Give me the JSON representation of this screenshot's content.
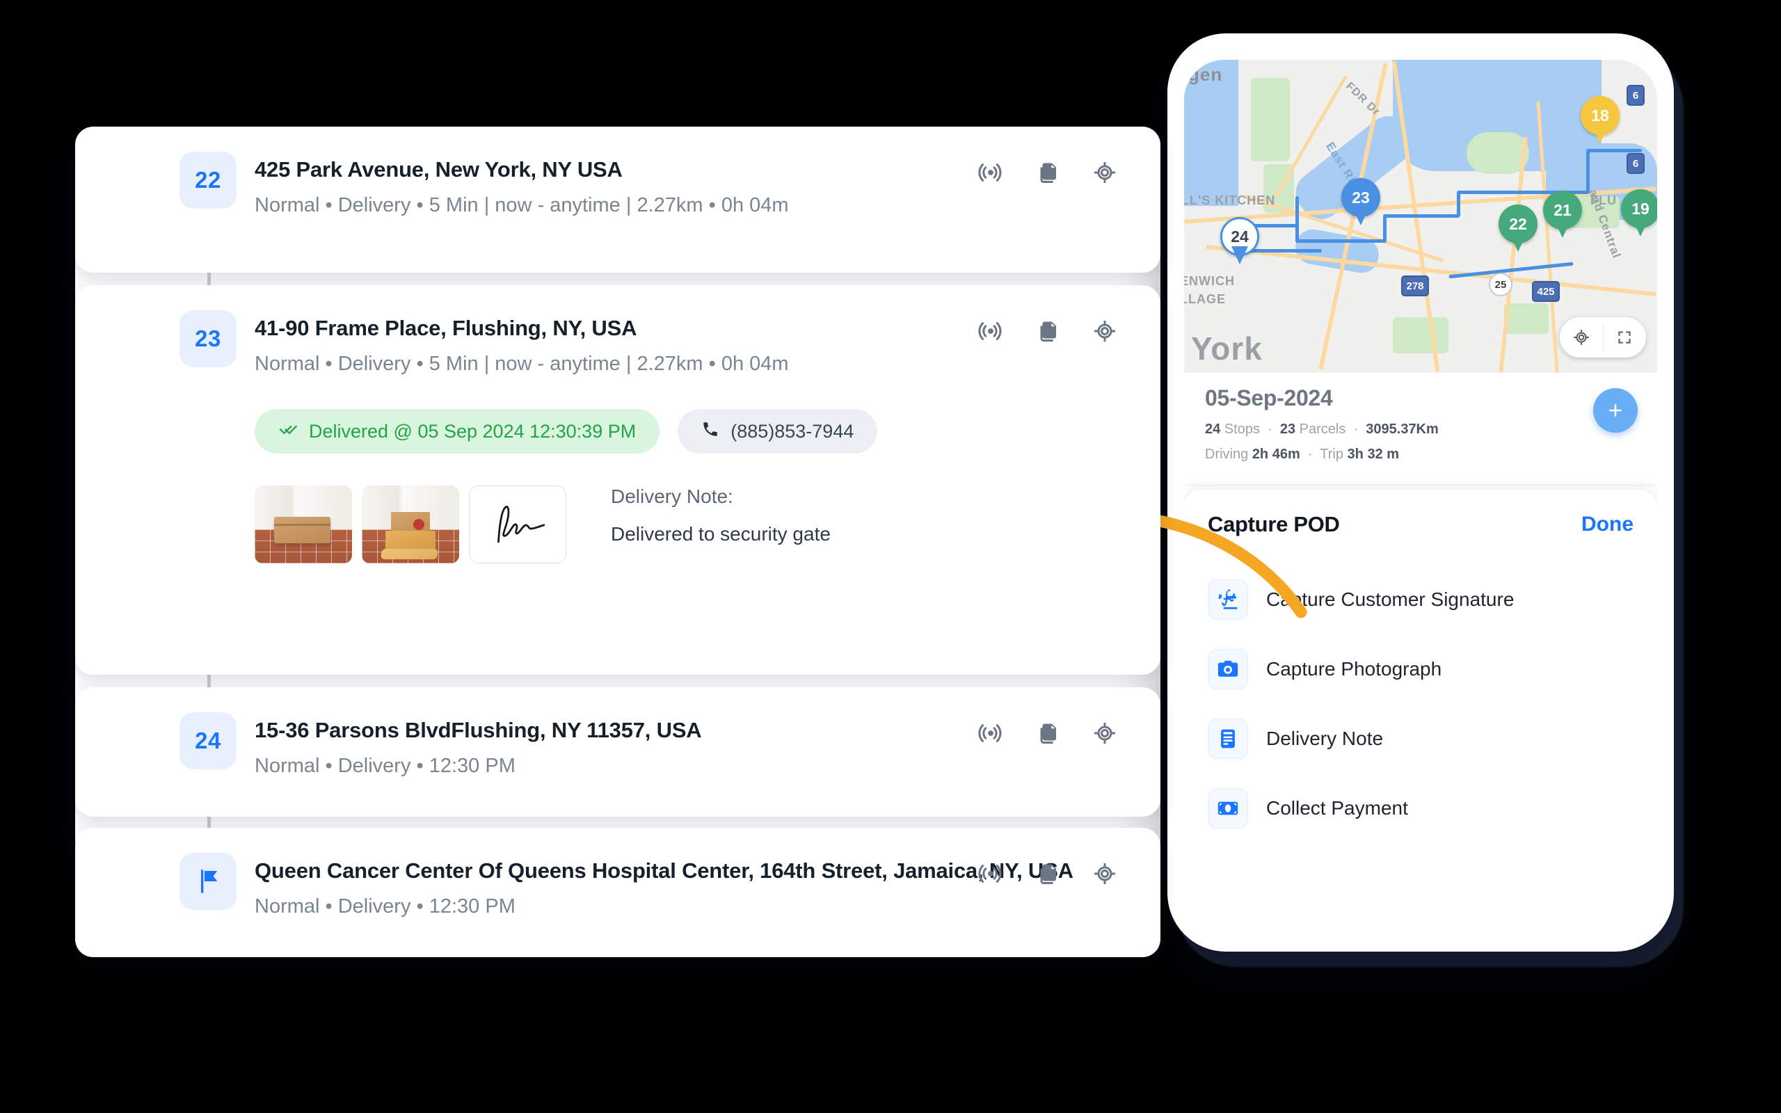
{
  "stop_list": {
    "rows": [
      {
        "badge": "22",
        "badge_type": "number",
        "address": "425 Park Avenue, New York, NY USA",
        "meta": "Normal • Delivery • 5 Min | now - anytime | 2.27km • 0h 04m",
        "actions": [
          "broadcast-icon",
          "copy-icon",
          "locate-icon"
        ]
      },
      {
        "badge": "23",
        "badge_type": "number",
        "address": "41-90 Frame Place, Flushing, NY, USA",
        "meta": "Normal  •  Delivery  •  5 Min | now - anytime | 2.27km • 0h 04m",
        "actions": [
          "broadcast-icon",
          "copy-icon",
          "locate-icon"
        ],
        "delivered_chip": "Delivered @ 05 Sep 2024 12:30:39 PM",
        "phone_chip": "(885)853-7944",
        "pod": {
          "photo_count": 2,
          "has_signature": true,
          "note_label": "Delivery Note:",
          "note_value": "Delivered to security gate"
        }
      },
      {
        "badge": "24",
        "badge_type": "number",
        "address": "15-36 Parsons BlvdFlushing, NY 11357, USA",
        "meta": "Normal  •  Delivery  •  12:30 PM",
        "actions": [
          "broadcast-icon",
          "copy-icon",
          "locate-icon"
        ]
      },
      {
        "badge": "",
        "badge_type": "flag",
        "address": "Queen Cancer Center Of Queens Hospital Center, 164th Street, Jamaica, NY, USA",
        "meta": "Normal  •  Delivery  •  12:30 PM",
        "actions": [
          "broadcast-icon",
          "copy-icon",
          "locate-icon"
        ]
      }
    ]
  },
  "phone": {
    "map": {
      "pins": [
        {
          "label": "18",
          "color": "yellow"
        },
        {
          "label": "23",
          "color": "blue"
        },
        {
          "label": "22",
          "color": "green"
        },
        {
          "label": "21",
          "color": "green"
        },
        {
          "label": "19",
          "color": "green"
        },
        {
          "label": "24",
          "color": "white"
        }
      ],
      "labels": [
        "gen",
        "FDR Dr",
        "East River",
        "LL'S KITCHEN",
        "FLU",
        "and Central",
        "ENWICH",
        "LLAGE",
        "York"
      ],
      "shields": [
        "278",
        "425",
        "25",
        "6",
        "6"
      ],
      "controls": [
        "recenter-icon",
        "fullscreen-icon"
      ]
    },
    "trip": {
      "date": "05-Sep-2024",
      "stops_count": "24",
      "stops_label": "Stops",
      "parcels_count": "23",
      "parcels_label": "Parcels",
      "distance": "3095.37Km",
      "driving_label": "Driving",
      "driving_value": "2h 46m",
      "trip_label": "Trip",
      "trip_value": "3h 32 m",
      "add_button": "add-icon"
    },
    "pod": {
      "title": "Capture POD",
      "done_label": "Done",
      "items": [
        {
          "label": "Capture Customer Signature",
          "icon": "signature-icon"
        },
        {
          "label": "Capture Photograph",
          "icon": "camera-icon"
        },
        {
          "label": "Delivery Note",
          "icon": "document-icon"
        },
        {
          "label": "Collect Payment",
          "icon": "cash-icon"
        }
      ]
    }
  },
  "annotation": {
    "arrow_color": "#F5A623",
    "arrow_direction": "right-to-left-curved"
  },
  "colors": {
    "accent_blue": "#1B76FF",
    "badge_bg": "#E8F0FE",
    "delivered_green": "#22A447",
    "delivered_bg": "#D9F4DF",
    "muted_text": "#7A8592",
    "arrow_orange": "#F5A623",
    "background": "#000000"
  }
}
